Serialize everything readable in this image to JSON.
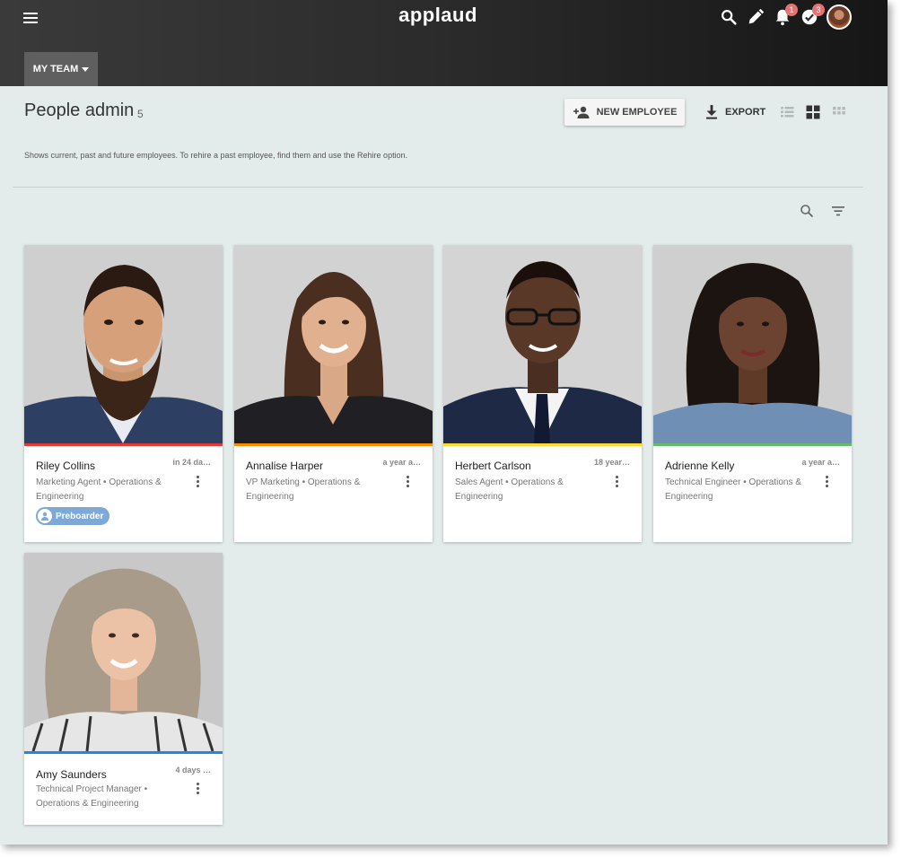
{
  "app": {
    "logo": "applaud"
  },
  "topbar": {
    "notifications_badge": "1",
    "tasks_badge": "3",
    "team_tab_label": "MY TEAM"
  },
  "header": {
    "title": "People admin",
    "count": "5",
    "new_employee_label": "NEW EMPLOYEE",
    "export_label": "EXPORT",
    "subtitle": "Shows current, past and future employees. To rehire a past employee, find them and use the Rehire option."
  },
  "employees": [
    {
      "name": "Riley Collins",
      "when": "in 24 da…",
      "role": "Marketing Agent • Operations & Engineering",
      "bar_color": "#e53935",
      "badge": "Preboarder"
    },
    {
      "name": "Annalise Harper",
      "when": "a year a…",
      "role": "VP Marketing • Operations & Engineering",
      "bar_color": "#fb8c00"
    },
    {
      "name": "Herbert Carlson",
      "when": "18 year…",
      "role": "Sales Agent • Operations & Engineering",
      "bar_color": "#fdd835"
    },
    {
      "name": "Adrienne Kelly",
      "when": "a year a…",
      "role": "Technical Engineer • Operations & Engineering",
      "bar_color": "#66bb6a"
    },
    {
      "name": "Amy Saunders",
      "when": "4 days …",
      "role": "Technical Project Manager • Operations & Engineering",
      "bar_color": "#1e88e5"
    }
  ],
  "icons": [
    "menu-icon",
    "search-icon",
    "edit-icon",
    "bell-icon",
    "check-circle-icon",
    "add-person-icon",
    "download-icon",
    "list-view-icon",
    "grid-view-icon",
    "small-grid-view-icon",
    "filter-icon",
    "more-vert-icon"
  ]
}
